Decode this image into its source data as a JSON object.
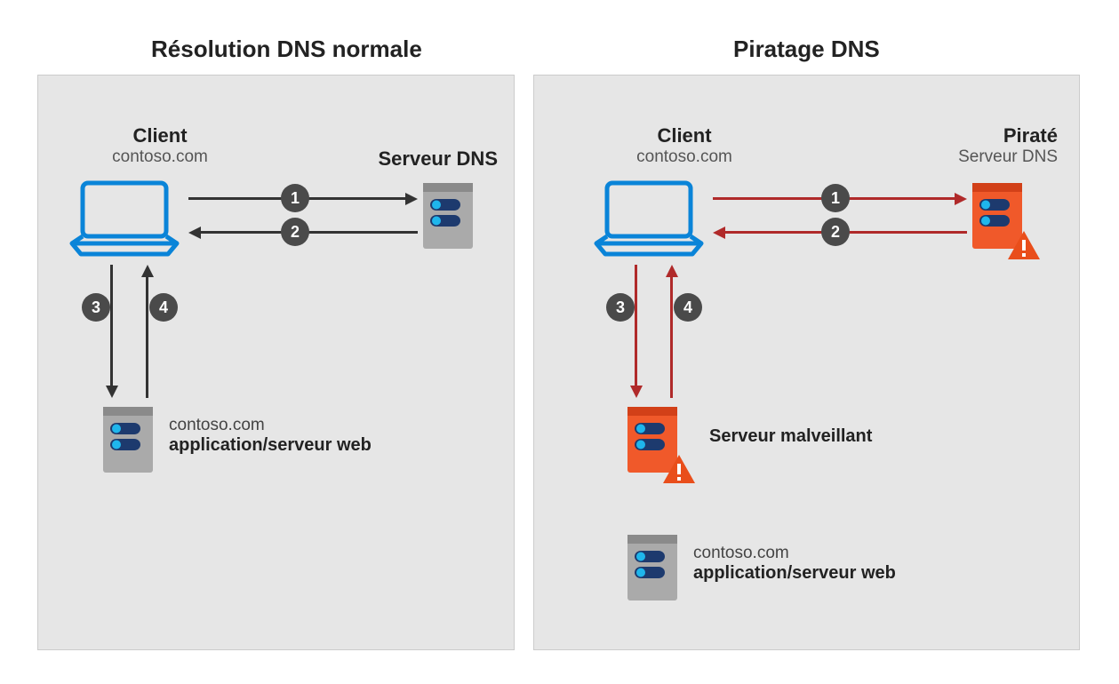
{
  "titles": {
    "left": "Résolution DNS normale",
    "right": "Piratage DNS"
  },
  "left": {
    "client_label": "Client",
    "client_domain": "contoso.com",
    "dns_label": "Serveur DNS",
    "steps": {
      "s1": "1",
      "s2": "2",
      "s3": "3",
      "s4": "4"
    },
    "webserver_line1": "contoso.com",
    "webserver_line2": "application/serveur web"
  },
  "right": {
    "client_label": "Client",
    "client_domain": "contoso.com",
    "pirated_label": "Piraté",
    "dns_label": "Serveur DNS",
    "steps": {
      "s1": "1",
      "s2": "2",
      "s3": "3",
      "s4": "4"
    },
    "malicious_label": "Serveur malveillant",
    "webserver_line1": "contoso.com",
    "webserver_line2": "application/serveur web"
  },
  "colors": {
    "blue": "#0a84d8",
    "grey_server": "#aaaaaa",
    "grey_server_dark": "#8a8a8a",
    "badge": "#4a4a4a",
    "red_arrow": "#b02a2a",
    "orange_server": "#f0592a",
    "orange_server_dark": "#d24018",
    "led_blue": "#1fb6ec",
    "led_dark": "#1d3a6e",
    "warn_fill": "#e94e1b"
  }
}
